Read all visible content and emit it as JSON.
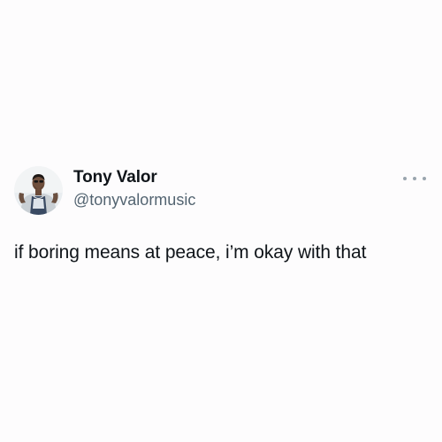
{
  "tweet": {
    "author": {
      "name": "Tony Valor",
      "handle": "@tonyvalormusic",
      "avatar": "profile-photo"
    },
    "text": "if boring means at peace, i’m okay with that",
    "more_icon": "more-options-icon"
  },
  "colors": {
    "background": "#fdfcfd",
    "text_primary": "#0f1419",
    "text_secondary": "#536471",
    "icon_muted": "#9aa5ae"
  }
}
